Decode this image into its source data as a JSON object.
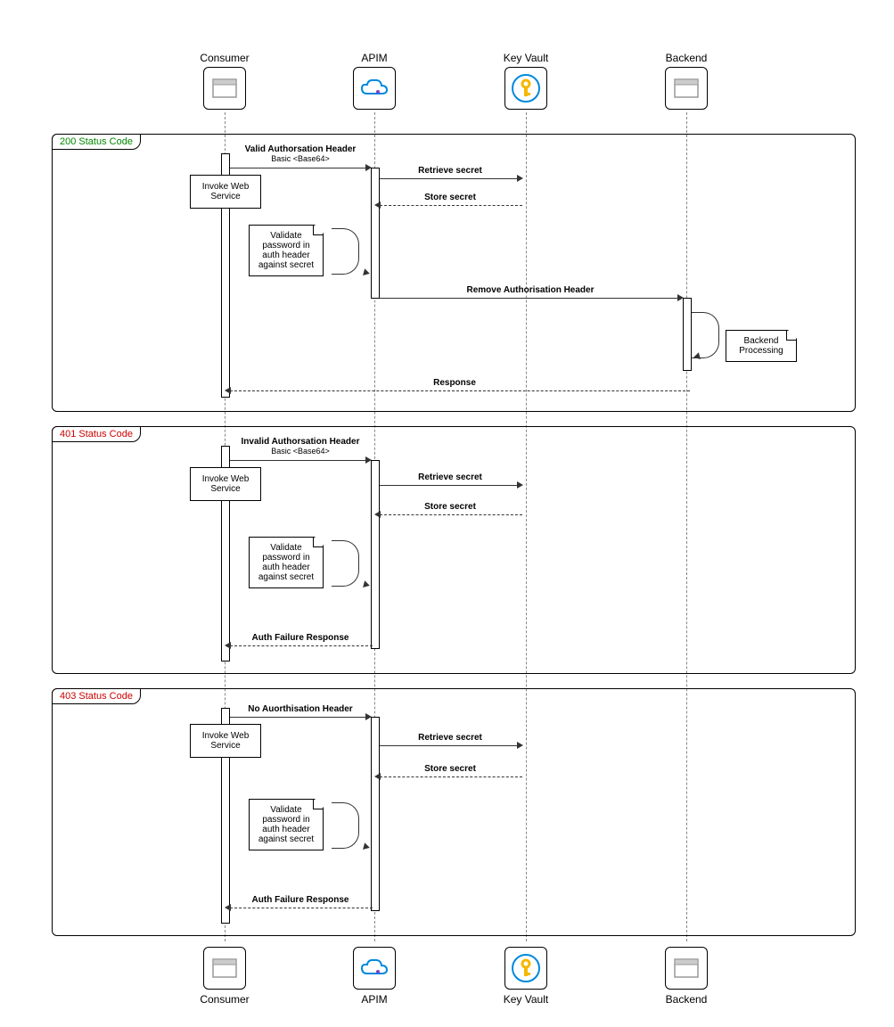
{
  "actors": {
    "consumer": "Consumer",
    "apim": "APIM",
    "keyvault": "Key Vault",
    "backend": "Backend"
  },
  "frames": {
    "f200": "200 Status Code",
    "f401": "401 Status Code",
    "f403": "403 Status Code"
  },
  "notes": {
    "invoke": "Invoke Web Service",
    "validate": "Validate password in auth header against secret",
    "backendproc": "Backend Processing"
  },
  "messages": {
    "validHeader": "Valid Authorsation Header",
    "invalidHeader": "Invalid Authorsation Header",
    "noHeader": "No Auorthisation Header",
    "basic": "Basic <Base64>",
    "retrieve": "Retrieve secret",
    "store": "Store secret",
    "removeAuth": "Remove Authorisation Header",
    "response": "Response",
    "authFail": "Auth Failure Response"
  }
}
